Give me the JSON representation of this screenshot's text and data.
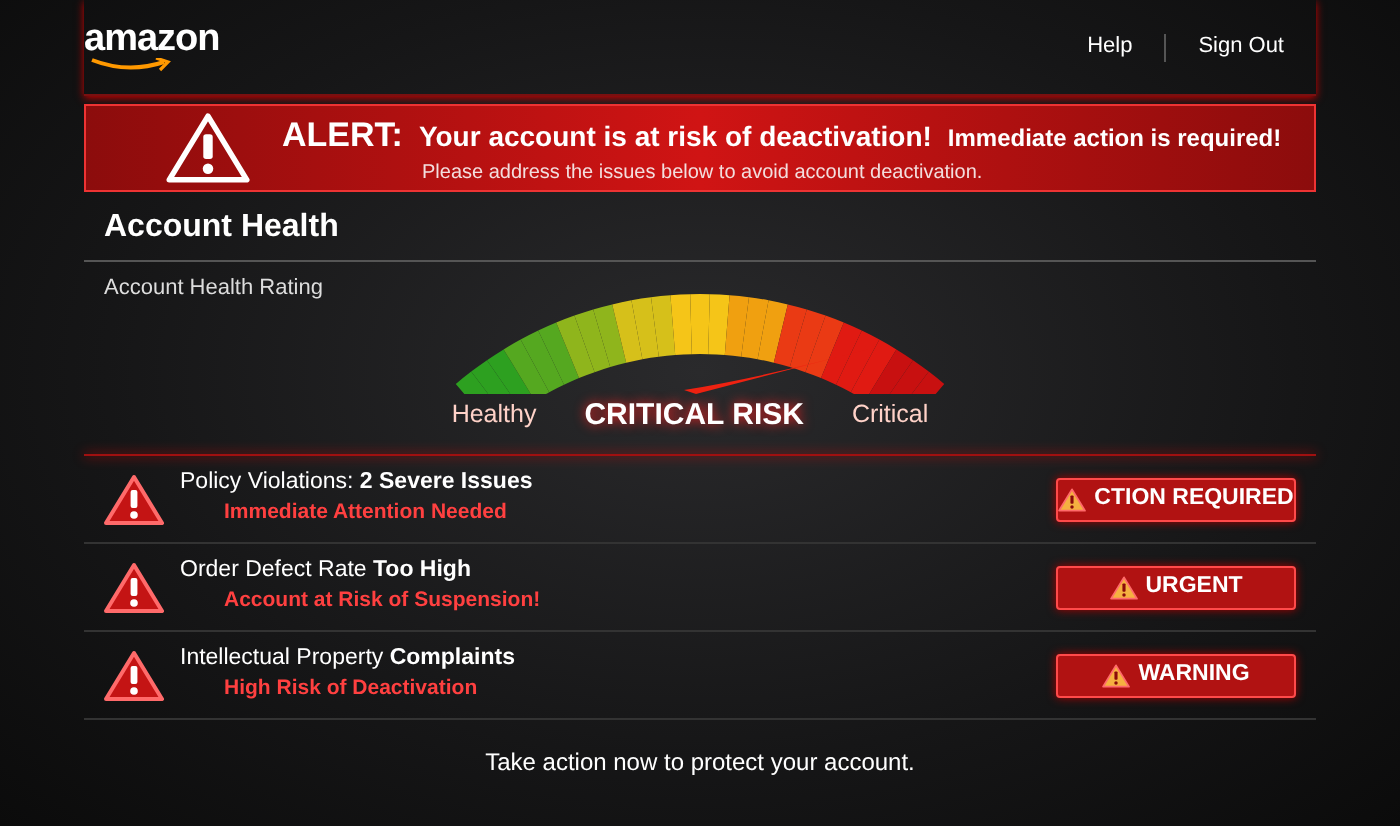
{
  "header": {
    "logo": "amazon",
    "links": [
      "Help",
      "Sign Out"
    ]
  },
  "alert": {
    "label": "ALERT:",
    "headline": "Your account is at risk of deactivation!",
    "extra": "Immediate action is required!",
    "subtext": "Please address the issues below to avoid account deactivation."
  },
  "section": {
    "title": "Account Health",
    "subtitle": "Account Health Rating"
  },
  "gauge": {
    "left_label": "Healthy",
    "status": "CRITICAL RISK",
    "right_label": "Critical"
  },
  "issues": [
    {
      "title": "Policy Violations: **2 Severe Issues**",
      "detail": "Immediate Attention Needed",
      "badge": "CTION REQUIRED"
    },
    {
      "title": "Order Defect Rate **Too High**",
      "detail": "Account at Risk of Suspension!",
      "badge": "URGENT"
    },
    {
      "title": "Intellectual Property **Complaints**",
      "detail": "High Risk of Deactivation",
      "badge": "WARNING"
    }
  ],
  "footer": "Take action now to protect your account."
}
